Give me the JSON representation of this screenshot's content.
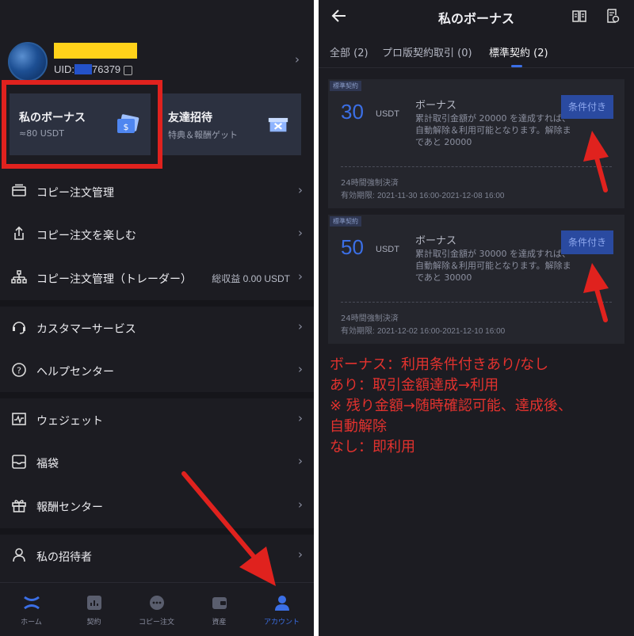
{
  "left": {
    "profile": {
      "uid_label": "UID:",
      "uid_tail": "76379"
    },
    "cards": [
      {
        "title": "私のボーナス",
        "sub": "≈80 USDT"
      },
      {
        "title": "友達招待",
        "sub": "特典＆報酬ゲット"
      }
    ],
    "menu": [
      {
        "label": "コピー注文管理",
        "icon": "card-icon",
        "extra": ""
      },
      {
        "label": "コピー注文を楽しむ",
        "icon": "share-icon",
        "extra": ""
      },
      {
        "label": "コピー注文管理（トレーダー）",
        "icon": "org-chart-icon",
        "extra": "総収益 0.00 USDT"
      },
      {
        "label": "カスタマーサービス",
        "icon": "headset-icon",
        "extra": ""
      },
      {
        "label": "ヘルプセンター",
        "icon": "help-icon",
        "extra": ""
      },
      {
        "label": "ウェジェット",
        "icon": "widget-icon",
        "extra": ""
      },
      {
        "label": "福袋",
        "icon": "lucky-bag-icon",
        "extra": ""
      },
      {
        "label": "報酬センター",
        "icon": "gift-icon",
        "extra": ""
      },
      {
        "label": "私の招待者",
        "icon": "person-icon",
        "extra": ""
      }
    ],
    "tabs": [
      {
        "label": "ホーム",
        "icon": "home-icon"
      },
      {
        "label": "契約",
        "icon": "contract-icon"
      },
      {
        "label": "コピー注文",
        "icon": "copy-trade-icon"
      },
      {
        "label": "資産",
        "icon": "wallet-icon"
      },
      {
        "label": "アカウント",
        "icon": "account-icon"
      }
    ],
    "accent": "#3b6fe6",
    "annotation_color": "#e0221e"
  },
  "right": {
    "title": "私のボーナス",
    "tabs": [
      "全部 (2)",
      "プロ版契約取引 (0)",
      "標準契約 (2)"
    ],
    "bonuses": [
      {
        "badge": "標準契約",
        "amount": "30",
        "currency": "USDT",
        "name": "ボーナス",
        "desc": "累計取引金額が 20000 を達成すれば、自動解除＆利用可能となります。解除まであと 20000",
        "button": "条件付き",
        "force": "24時間強制決済",
        "period_label": "有効期限:",
        "period": "2021-11-30 16:00-2021-12-08 16:00"
      },
      {
        "badge": "標準契約",
        "amount": "50",
        "currency": "USDT",
        "name": "ボーナス",
        "desc": "累計取引金額が 30000 を達成すれば、自動解除＆利用可能となります。解除まであと 30000",
        "button": "条件付き",
        "force": "24時間強制決済",
        "period_label": "有効期限:",
        "period": "2021-12-02 16:00-2021-12-10 16:00"
      }
    ],
    "notes": [
      "ボーナス：利用条件付きあり/なし",
      "あり：取引金額達成→利用",
      "※ 残り金額→随時確認可能、達成後、",
      "自動解除",
      "なし：即利用"
    ]
  }
}
